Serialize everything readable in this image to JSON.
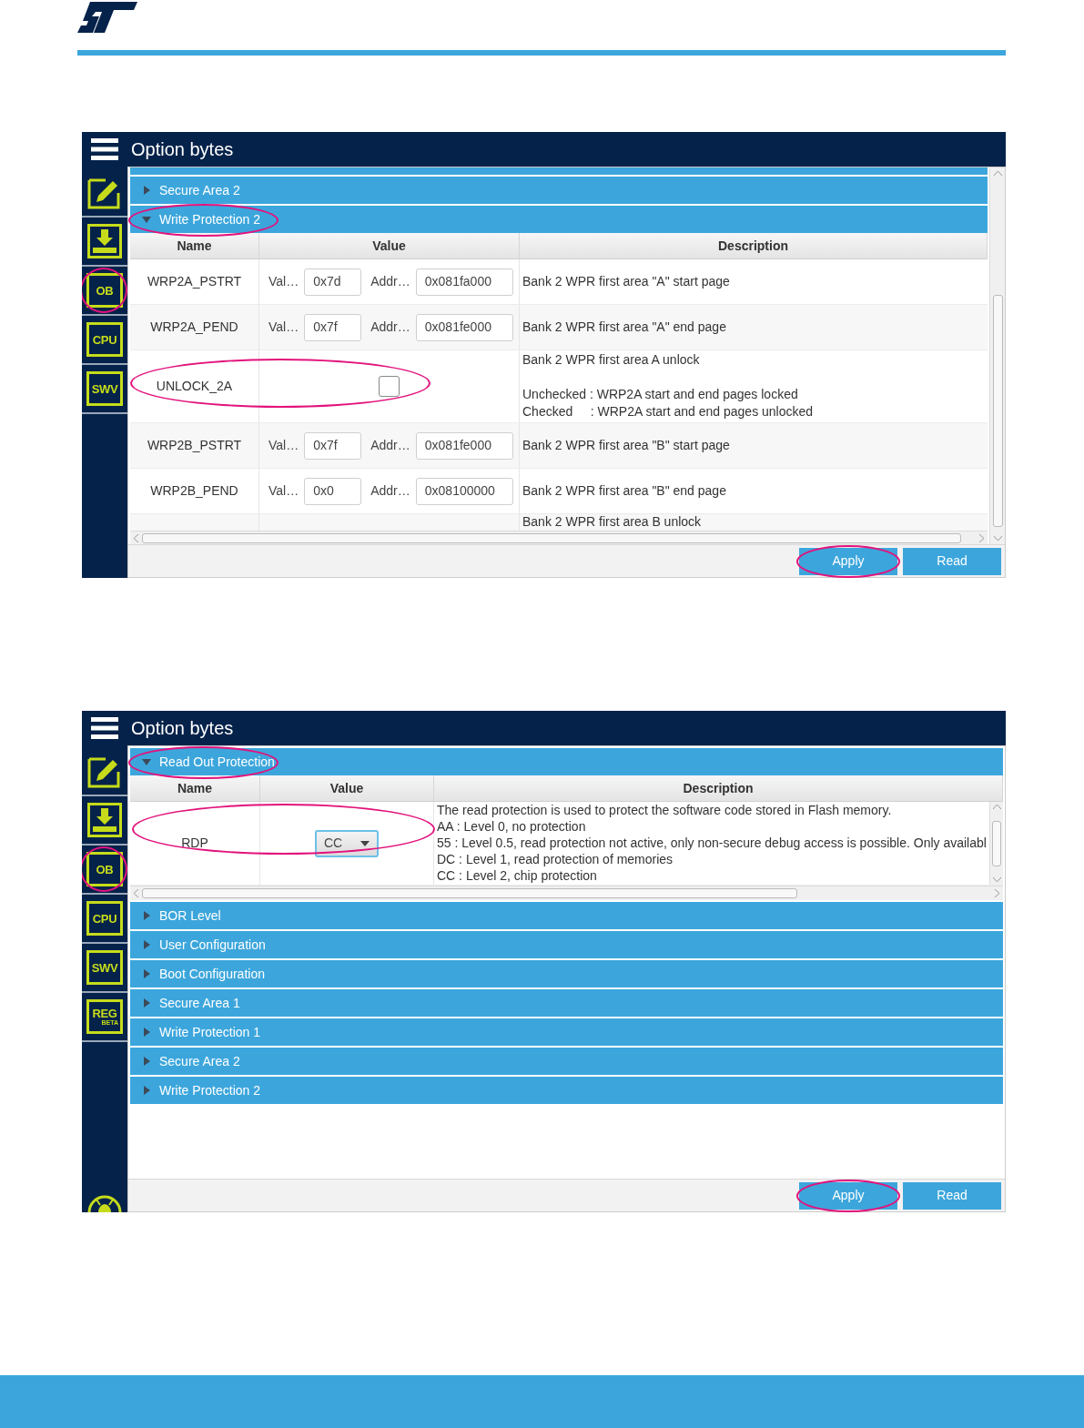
{
  "screens": [
    {
      "title": "Option bytes",
      "sidebar": [
        {
          "kind": "icon",
          "highlighted": false
        },
        {
          "kind": "icon",
          "highlighted": false
        },
        {
          "kind": "text",
          "label": "OB",
          "highlighted": true
        },
        {
          "kind": "text",
          "label": "CPU",
          "highlighted": false
        },
        {
          "kind": "text",
          "label": "SWV",
          "highlighted": false
        }
      ],
      "vertical_scrollbar": true,
      "sections": [
        {
          "kind": "partial"
        },
        {
          "kind": "section",
          "label": "Secure Area 2",
          "expanded": false,
          "highlighted": false
        },
        {
          "kind": "section",
          "label": "Write Protection 2",
          "expanded": true,
          "highlighted": true,
          "table": {
            "columns": [
              "Name",
              "Value",
              "Description"
            ],
            "rows": [
              {
                "kind": "fields",
                "name": "WRP2A_PSTRT",
                "value_label": "Val…",
                "value": "0x7d",
                "address_label": "Addr…",
                "address": "0x081fa000",
                "description": [
                  [
                    "Bank 2 WPR first area \"A\" start page"
                  ]
                ]
              },
              {
                "kind": "fields",
                "name": "WRP2A_PEND",
                "value_label": "Val…",
                "value": "0x7f",
                "address_label": "Addr…",
                "address": "0x081fe000",
                "description": [
                  [
                    "Bank 2 WPR first area \"A\" end page"
                  ]
                ]
              },
              {
                "kind": "checkbox",
                "name": "UNLOCK_2A",
                "checked": false,
                "highlighted": true,
                "description": [
                  [
                    "Bank 2 WPR first area A unlock"
                  ],
                  [
                    "Unchecked : WRP2A start and end pages locked",
                    "Checked     : WRP2A start and end pages unlocked"
                  ]
                ]
              },
              {
                "kind": "fields",
                "name": "WRP2B_PSTRT",
                "value_label": "Val…",
                "value": "0x7f",
                "address_label": "Addr…",
                "address": "0x081fe000",
                "description": [
                  [
                    "Bank 2 WPR first area \"B\" start page"
                  ]
                ]
              },
              {
                "kind": "fields",
                "name": "WRP2B_PEND",
                "value_label": "Val…",
                "value": "0x0",
                "address_label": "Addr…",
                "address": "0x08100000",
                "description": [
                  [
                    "Bank 2 WPR first area \"B\" end page"
                  ]
                ]
              },
              {
                "kind": "partial",
                "description": [
                  [
                    "Bank 2 WPR first area B unlock"
                  ]
                ]
              }
            ]
          }
        }
      ],
      "buttons": [
        {
          "label": "Apply",
          "highlighted": true
        },
        {
          "label": "Read",
          "highlighted": false
        }
      ]
    },
    {
      "title": "Option bytes",
      "sidebar": [
        {
          "kind": "icon",
          "highlighted": false
        },
        {
          "kind": "icon",
          "highlighted": false
        },
        {
          "kind": "text",
          "label": "OB",
          "highlighted": true
        },
        {
          "kind": "text",
          "label": "CPU",
          "highlighted": false
        },
        {
          "kind": "text",
          "label": "SWV",
          "highlighted": false
        },
        {
          "kind": "text",
          "label": "REG",
          "sublabel": "BETA",
          "highlighted": false
        },
        {
          "kind": "pinned"
        }
      ],
      "vertical_scrollbar": false,
      "sections": [
        {
          "kind": "section",
          "label": "Read Out Protection",
          "expanded": true,
          "highlighted": true,
          "table": {
            "columns": [
              "Name",
              "Value",
              "Description"
            ],
            "rows": [
              {
                "kind": "dropdown",
                "name": "RDP",
                "value": "CC",
                "highlighted": true,
                "description": [
                  [
                    "The read protection is used to protect the software code stored in Flash memory.",
                    "AA : Level 0, no protection",
                    "55 : Level 0.5, read protection not active, only non-secure debug access is possible. Only availabl",
                    "DC : Level 1, read protection of memories",
                    "CC : Level 2, chip protection"
                  ]
                ]
              }
            ]
          }
        },
        {
          "kind": "section",
          "label": "BOR Level",
          "expanded": false,
          "highlighted": false
        },
        {
          "kind": "section",
          "label": "User Configuration",
          "expanded": false,
          "highlighted": false
        },
        {
          "kind": "section",
          "label": "Boot Configuration",
          "expanded": false,
          "highlighted": false
        },
        {
          "kind": "section",
          "label": "Secure Area 1",
          "expanded": false,
          "highlighted": false
        },
        {
          "kind": "section",
          "label": "Write Protection 1",
          "expanded": false,
          "highlighted": false
        },
        {
          "kind": "section",
          "label": "Secure Area 2",
          "expanded": false,
          "highlighted": false
        },
        {
          "kind": "section",
          "label": "Write Protection 2",
          "expanded": false,
          "highlighted": false
        }
      ],
      "buttons": [
        {
          "label": "Apply",
          "highlighted": true
        },
        {
          "label": "Read",
          "highlighted": false
        }
      ]
    }
  ]
}
